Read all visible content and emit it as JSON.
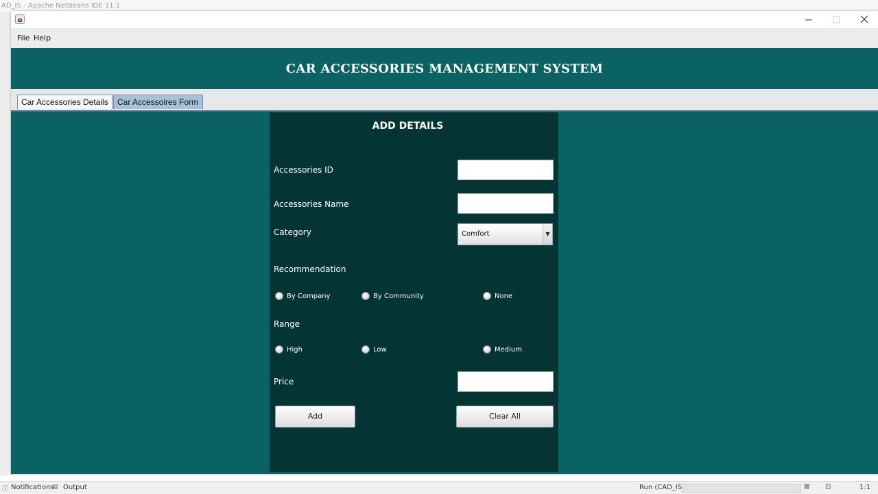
{
  "ide": {
    "title": "AD_IS - Apache NetBeans IDE 11.1",
    "status": {
      "notifications": "Notifications",
      "output": "Output",
      "run": "Run (CAD_IS)",
      "position": "1:1"
    }
  },
  "menu": {
    "file": "File",
    "help": "Help"
  },
  "banner": {
    "title": "CAR ACCESSORIES MANAGEMENT SYSTEM"
  },
  "tabs": [
    {
      "label": "Car Accessories Details",
      "selected": false
    },
    {
      "label": "Car Accessoires Form",
      "selected": true
    }
  ],
  "form": {
    "title": "ADD DETAILS",
    "accessories_id": {
      "label": "Accessories ID",
      "value": ""
    },
    "accessories_name": {
      "label": "Accessories Name",
      "value": ""
    },
    "category": {
      "label": "Category",
      "selected": "Comfort"
    },
    "recommendation": {
      "label": "Recommendation",
      "options": [
        "By Company",
        "By Community",
        "None"
      ]
    },
    "range": {
      "label": "Range",
      "options": [
        "High",
        "Low",
        "Medium"
      ]
    },
    "price": {
      "label": "Price",
      "value": ""
    },
    "add_label": "Add",
    "clear_label": "Clear All"
  },
  "colors": {
    "window_bg": "#0a6262",
    "panel_bg": "#043434",
    "selected_tab": "#a5c1d9"
  }
}
